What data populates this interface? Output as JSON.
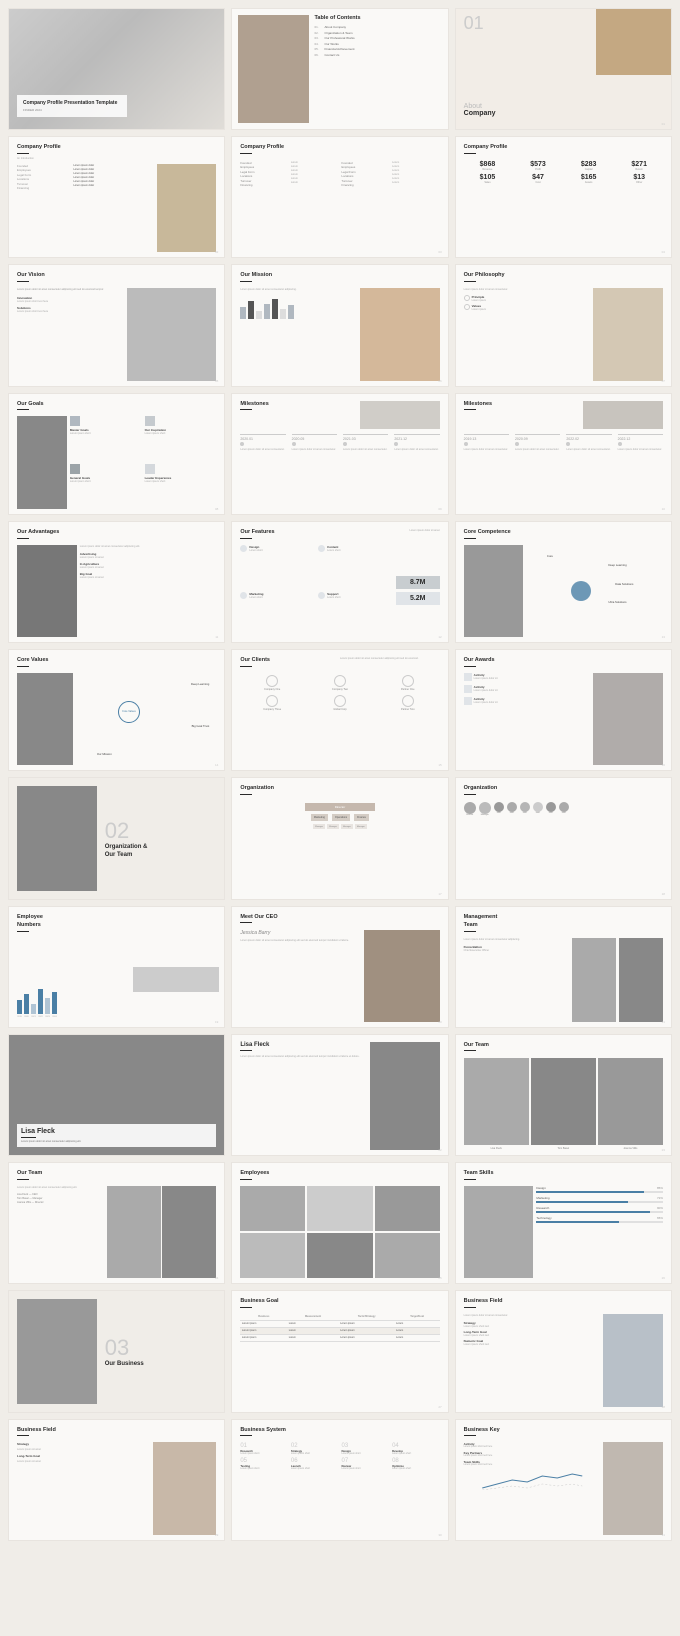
{
  "page": {
    "title": "Presentation Template",
    "background": "#f0ede8"
  },
  "slides": [
    {
      "id": "s1",
      "type": "cover",
      "title": "Company Profile Presentation Template",
      "subtitle": "FINDER 2024"
    },
    {
      "id": "s2",
      "type": "toc",
      "title": "Table of Contents",
      "items": [
        "01. About Company",
        "02. Organization & Team",
        "03. Our Profesional Works",
        "04. Our Works",
        "05. Financial Achievement",
        "06. Contact Us"
      ]
    },
    {
      "id": "s3",
      "type": "about",
      "number": "01",
      "title": "About",
      "subtitle": "Company"
    },
    {
      "id": "s4",
      "type": "company-profile-1",
      "title": "Company Profile",
      "subtitle": "An Introduction"
    },
    {
      "id": "s5",
      "type": "company-profile-2",
      "title": "Company Profile"
    },
    {
      "id": "s6",
      "type": "company-profile-stats",
      "title": "Company Profile",
      "stats": [
        {
          "value": "$868",
          "label": "Revenue"
        },
        {
          "value": "$573",
          "label": "Profit"
        },
        {
          "value": "$283",
          "label": "Capital"
        },
        {
          "value": "$271",
          "label": "Return"
        },
        {
          "value": "$105",
          "label": "Sales"
        },
        {
          "value": "$47",
          "label": "Cost"
        },
        {
          "value": "$165",
          "label": "Assets"
        },
        {
          "value": "$13",
          "label": "Other"
        }
      ]
    },
    {
      "id": "s7",
      "type": "our-vision",
      "title": "Our Vision"
    },
    {
      "id": "s8",
      "type": "our-mission",
      "title": "Our Mission"
    },
    {
      "id": "s9",
      "type": "our-philosophy",
      "title": "Our Philosophy"
    },
    {
      "id": "s10",
      "type": "our-goals",
      "title": "Our Goals"
    },
    {
      "id": "s11",
      "type": "milestones-1",
      "title": "Milestones",
      "years": [
        "2020.01",
        "2020.05",
        "2021.03",
        "2021.12"
      ]
    },
    {
      "id": "s12",
      "type": "milestones-2",
      "title": "Milestones",
      "years": [
        "2019.13",
        "2020.09",
        "2022.02",
        "2022.12"
      ]
    },
    {
      "id": "s13",
      "type": "our-advantages",
      "title": "Our Advantages"
    },
    {
      "id": "s14",
      "type": "our-features",
      "title": "Our Features",
      "numbers": [
        "8.7M",
        "5.2M"
      ]
    },
    {
      "id": "s15",
      "type": "core-competence",
      "title": "Core Competence"
    },
    {
      "id": "s16",
      "type": "core-values",
      "title": "Core Values"
    },
    {
      "id": "s17",
      "type": "our-clients",
      "title": "Our Clients"
    },
    {
      "id": "s18",
      "type": "our-awards",
      "title": "Our Awards"
    },
    {
      "id": "s19",
      "type": "section-2",
      "number": "02",
      "title": "Organization &",
      "subtitle": "Our Team"
    },
    {
      "id": "s20",
      "type": "organization-1",
      "title": "Organization"
    },
    {
      "id": "s21",
      "type": "organization-2",
      "title": "Organization"
    },
    {
      "id": "s22",
      "type": "employee-numbers",
      "title": "Employee Numbers"
    },
    {
      "id": "s23",
      "type": "meet-ceo",
      "title": "Meet Our CEO",
      "name": "Jessica Barry"
    },
    {
      "id": "s24",
      "type": "management-team",
      "title": "Management Team"
    },
    {
      "id": "s25",
      "type": "lisa-fleck-1",
      "name": "Lisa Fleck"
    },
    {
      "id": "s26",
      "type": "lisa-fleck-2",
      "name": "Lisa Fleck"
    },
    {
      "id": "s27",
      "type": "our-team-1",
      "title": "Our Team"
    },
    {
      "id": "s28",
      "type": "our-team-2",
      "title": "Our Team"
    },
    {
      "id": "s29",
      "type": "employees",
      "title": "Employees"
    },
    {
      "id": "s30",
      "type": "team-skills",
      "title": "Team Skills"
    },
    {
      "id": "s31",
      "type": "section-3",
      "number": "03",
      "title": "Our Business"
    },
    {
      "id": "s32",
      "type": "business-goal",
      "title": "Business Goal",
      "columns": [
        "Business",
        "Measurement",
        "Tactic/Strategy",
        "Target/Goal"
      ]
    },
    {
      "id": "s33",
      "type": "business-field-1",
      "title": "Business Field"
    },
    {
      "id": "s34",
      "type": "business-field-2",
      "title": "Business Field"
    },
    {
      "id": "s35",
      "type": "business-system",
      "title": "Business System",
      "steps": [
        "01",
        "02",
        "03",
        "04",
        "05",
        "06",
        "07",
        "08"
      ]
    },
    {
      "id": "s36",
      "type": "business-key",
      "title": "Business Key"
    }
  ]
}
